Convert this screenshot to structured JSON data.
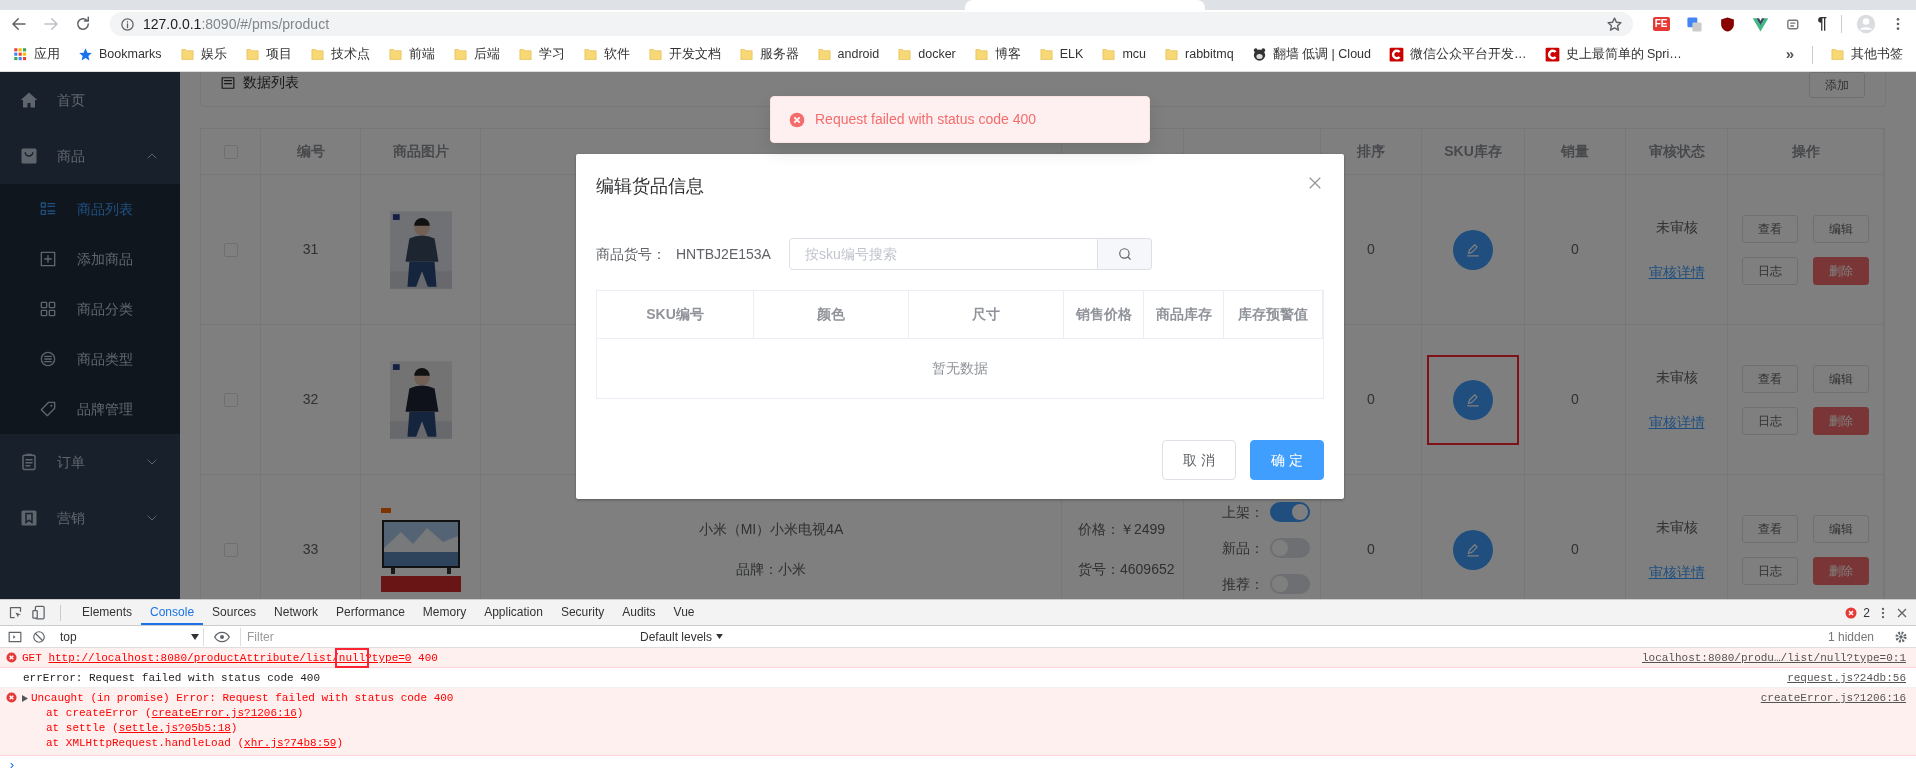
{
  "browser": {
    "address": {
      "host": "127.0.0.1",
      "path": ":8090/#/pms/product"
    },
    "extensions": [
      {
        "kind": "fe",
        "label": "FE"
      },
      {
        "kind": "translate"
      },
      {
        "kind": "shield"
      },
      {
        "kind": "vee"
      },
      {
        "kind": "reader"
      },
      {
        "kind": "pilcrow",
        "label": "¶"
      }
    ],
    "bookmarks": [
      {
        "kind": "apps",
        "label": "应用"
      },
      {
        "kind": "star",
        "label": "Bookmarks"
      },
      {
        "kind": "folder",
        "label": "娱乐"
      },
      {
        "kind": "folder",
        "label": "项目"
      },
      {
        "kind": "folder",
        "label": "技术点"
      },
      {
        "kind": "folder",
        "label": "前端"
      },
      {
        "kind": "folder",
        "label": "后端"
      },
      {
        "kind": "folder",
        "label": "学习"
      },
      {
        "kind": "folder",
        "label": "软件"
      },
      {
        "kind": "folder",
        "label": "开发文档"
      },
      {
        "kind": "folder",
        "label": "服务器"
      },
      {
        "kind": "folder",
        "label": "android"
      },
      {
        "kind": "folder",
        "label": "docker"
      },
      {
        "kind": "folder",
        "label": "博客"
      },
      {
        "kind": "folder",
        "label": "ELK"
      },
      {
        "kind": "folder",
        "label": "mcu"
      },
      {
        "kind": "folder",
        "label": "rabbitmq"
      },
      {
        "kind": "mascot",
        "label": "翻墙 低调 | Cloud"
      },
      {
        "kind": "c",
        "label": "微信公众平台开发…"
      },
      {
        "kind": "c",
        "label": "史上最简单的 Spri…"
      }
    ],
    "more": "»",
    "other_bookmarks": {
      "kind": "folder",
      "label": "其他书签"
    }
  },
  "sidebar": {
    "items": [
      {
        "label": "首页"
      },
      {
        "label": "商品",
        "expanded": true,
        "children": [
          {
            "label": "商品列表",
            "selected": true
          },
          {
            "label": "添加商品",
            "selected": false
          },
          {
            "label": "商品分类",
            "selected": false
          },
          {
            "label": "商品类型",
            "selected": false
          },
          {
            "label": "品牌管理",
            "selected": false
          }
        ]
      },
      {
        "label": "订单",
        "expanded": false
      },
      {
        "label": "营销",
        "expanded": false
      }
    ]
  },
  "page": {
    "section_title": "数据列表",
    "add_button": "添加",
    "table": {
      "all_checked": false,
      "columns": [
        "编号",
        "商品图片",
        null,
        null,
        null,
        "排序",
        "SKU库存",
        "销量",
        "审核状态",
        "操作"
      ],
      "rows": [
        {
          "checked": false,
          "id": "31",
          "sort": "0",
          "sku_highlighted": false,
          "sales": "0",
          "status": "未审核",
          "status_link": "审核详情",
          "actions": [
            {
              "label": "查看",
              "kind": "default"
            },
            {
              "label": "编辑",
              "kind": "default"
            },
            {
              "label": "日志",
              "kind": "default"
            },
            {
              "label": "删除",
              "kind": "danger"
            }
          ]
        },
        {
          "checked": false,
          "id": "32",
          "sort": "0",
          "sku_highlighted": true,
          "sales": "0",
          "status": "未审核",
          "status_link": "审核详情",
          "actions": [
            {
              "label": "查看",
              "kind": "default"
            },
            {
              "label": "编辑",
              "kind": "default"
            },
            {
              "label": "日志",
              "kind": "default"
            },
            {
              "label": "删除",
              "kind": "danger"
            }
          ]
        },
        {
          "checked": false,
          "id": "33",
          "name": "小米（MI）小米电视4A",
          "brand": "品牌：小米",
          "price": "价格：￥2499",
          "code": "货号：4609652",
          "tags": [
            {
              "label": "上架：",
              "on": true
            },
            {
              "label": "新品：",
              "on": false
            },
            {
              "label": "推荐：",
              "on": false
            }
          ],
          "sort": "0",
          "sku_highlighted": false,
          "sales": "0",
          "status": "未审核",
          "status_link": "审核详情",
          "actions": [
            {
              "label": "查看",
              "kind": "default"
            },
            {
              "label": "编辑",
              "kind": "default"
            },
            {
              "label": "日志",
              "kind": "default"
            },
            {
              "label": "删除",
              "kind": "danger"
            }
          ]
        }
      ]
    }
  },
  "toast": {
    "kind": "error",
    "text": "Request failed with status code 400"
  },
  "modal": {
    "title": "编辑货品信息",
    "code_label": "商品货号：",
    "code_value": "HNTBJ2E153A",
    "search": {
      "placeholder": "按sku编号搜索"
    },
    "columns": [
      "SKU编号",
      "颜色",
      "尺寸",
      "销售价格",
      "商品库存",
      "库存预警值"
    ],
    "empty_text": "暂无数据",
    "buttons": [
      {
        "label": "取 消",
        "kind": "default"
      },
      {
        "label": "确 定",
        "kind": "primary"
      }
    ]
  },
  "devtools": {
    "tabs": [
      {
        "label": "Elements",
        "selected": false
      },
      {
        "label": "Console",
        "selected": true
      },
      {
        "label": "Sources",
        "selected": false
      },
      {
        "label": "Network",
        "selected": false
      },
      {
        "label": "Performance",
        "selected": false
      },
      {
        "label": "Memory",
        "selected": false
      },
      {
        "label": "Application",
        "selected": false
      },
      {
        "label": "Security",
        "selected": false
      },
      {
        "label": "Audits",
        "selected": false
      },
      {
        "label": "Vue",
        "selected": false
      }
    ],
    "error_count": "2",
    "context": "top",
    "filter": {
      "placeholder": "Filter"
    },
    "levels": "Default levels",
    "hidden": "1 hidden",
    "messages": [
      {
        "kind": "error",
        "before": "GET ",
        "link": {
          "before": "http://localhost:8080/productAttribute/list/",
          "marked": "null",
          "after": "?type=0"
        },
        "after": " 400",
        "source": "localhost:8080/produ…/list/null?type=0:1"
      },
      {
        "kind": "log",
        "text": "errError: Request failed with status code 400",
        "source": "request.js?24db:56"
      },
      {
        "kind": "error",
        "expanded": false,
        "text": "Uncaught (in promise) Error: Request failed with status code 400",
        "source": "createError.js?1206:16",
        "stack": [
          {
            "before": "at createError (",
            "link": "createError.js?1206:16",
            "after": ")"
          },
          {
            "before": "at settle (",
            "link": "settle.js?05b5:18",
            "after": ")"
          },
          {
            "before": "at XMLHttpRequest.handleLoad (",
            "link": "xhr.js?74b8:59",
            "after": ")"
          }
        ]
      }
    ],
    "prompt": "›"
  }
}
